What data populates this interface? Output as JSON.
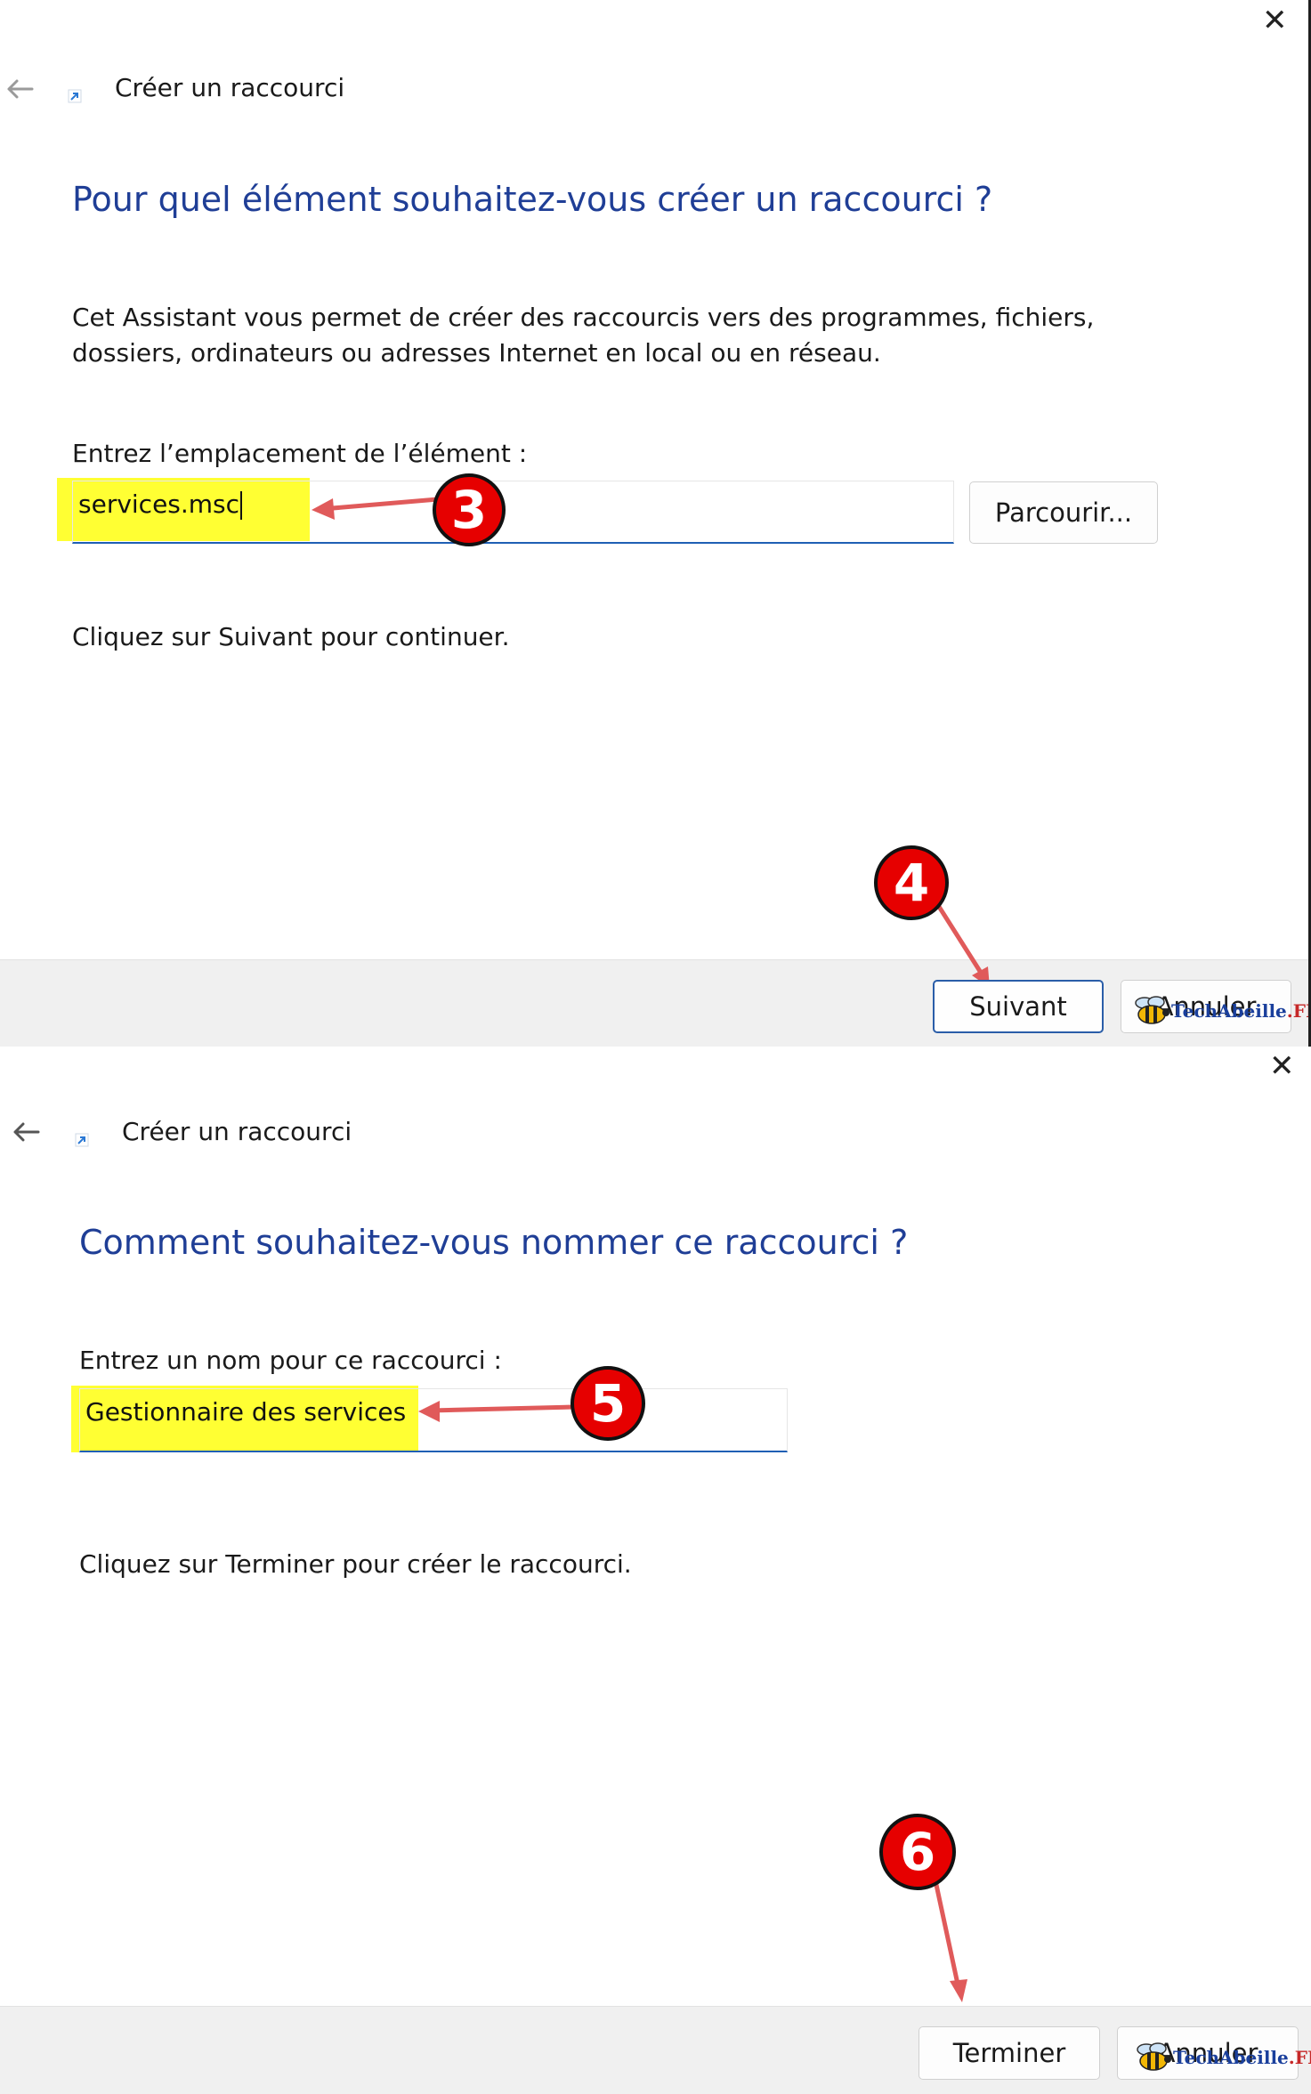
{
  "dialog1": {
    "window_title": "Créer un raccourci",
    "heading": "Pour quel élément souhaitez-vous créer un raccourci ?",
    "description": "Cet Assistant vous permet de créer des raccourcis vers des programmes, fichiers, dossiers, ordinateurs ou adresses Internet en local ou en réseau.",
    "location_label": "Entrez l’emplacement de l’élément :",
    "location_value": "services.msc",
    "browse_button": "Parcourir...",
    "instruction": "Cliquez sur Suivant pour continuer.",
    "next_button": "Suivant",
    "cancel_button": "Annuler",
    "step_badges": [
      "3",
      "4"
    ]
  },
  "dialog2": {
    "window_title": "Créer un raccourci",
    "heading": "Comment souhaitez-vous nommer ce raccourci ?",
    "name_label": "Entrez un nom pour ce raccourci :",
    "name_value": "Gestionnaire des services",
    "instruction": "Cliquez sur Terminer pour créer le raccourci.",
    "finish_button": "Terminer",
    "cancel_button": "Annuler",
    "step_badges": [
      "5",
      "6"
    ]
  },
  "watermark": {
    "brand": "TechAbeille",
    "suffix": ".FR"
  },
  "icons": {
    "close": "close-icon",
    "back": "back-arrow-icon",
    "shortcut": "shortcut-icon",
    "bee": "bee-icon"
  },
  "colors": {
    "heading": "#1f3e96",
    "highlight": "#ffff33",
    "annotation_red": "#e60000",
    "arrow": "#e05a5a",
    "input_underline": "#1f5fb4",
    "footer_bg": "#f0f0f0"
  }
}
